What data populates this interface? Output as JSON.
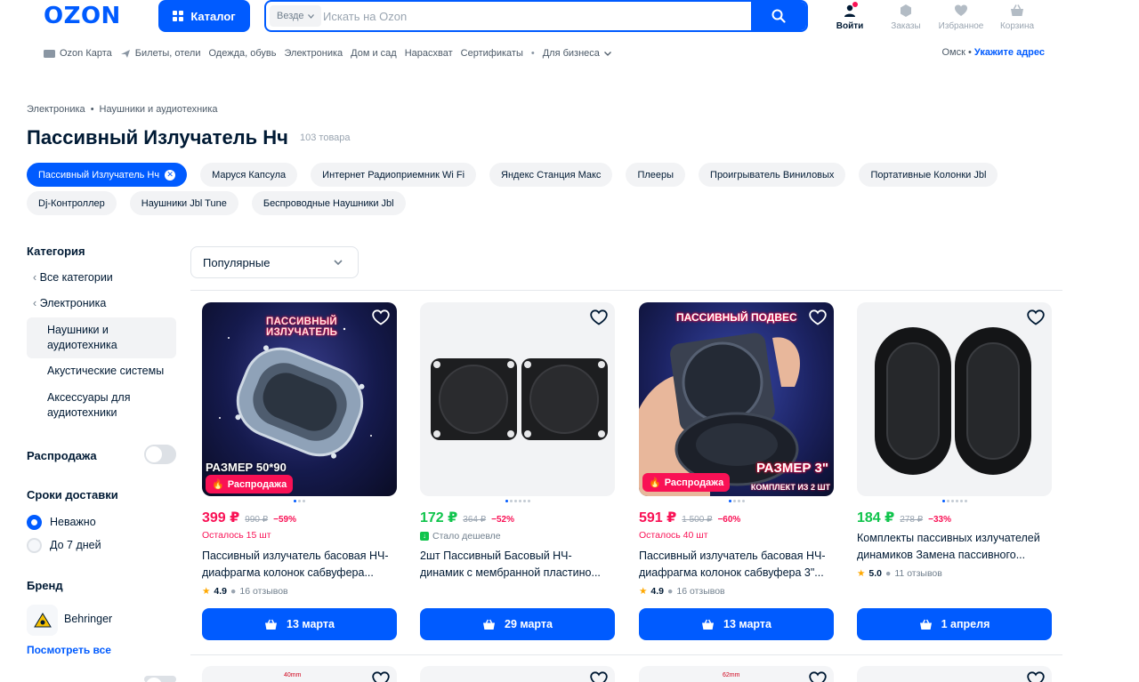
{
  "header": {
    "logo": "OZON",
    "catalog_label": "Каталог",
    "search_scope": "Везде",
    "search_placeholder": "Искать на Ozon",
    "login_label": "Войти",
    "orders_label": "Заказы",
    "favorites_label": "Избранное",
    "cart_label": "Корзина"
  },
  "subnav": {
    "items": [
      "Ozon Карта",
      "Билеты, отели",
      "Одежда, обувь",
      "Электроника",
      "Дом и сад",
      "Нарасхват",
      "Сертификаты",
      "Для бизнеса"
    ],
    "city": "Омск",
    "address_link": "Укажите адрес"
  },
  "breadcrumb": [
    "Электроника",
    "Наушники и аудиотехника"
  ],
  "page": {
    "title": "Пассивный Излучатель Нч",
    "count": "103 товара"
  },
  "chips": [
    "Пассивный Излучатель Нч",
    "Маруся Капсула",
    "Интернет Радиоприемник Wi Fi",
    "Яндекс Станция Макс",
    "Плееры",
    "Проигрыватель Виниловых",
    "Портативные Колонки Jbl",
    "Dj-Контроллер",
    "Наушники Jbl Tune",
    "Беспроводные Наушники Jbl"
  ],
  "sidebar": {
    "category_title": "Категория",
    "all_categories": "Все категории",
    "electronics": "Электроника",
    "current": "Наушники и аудиотехника",
    "sub1": "Акустические системы",
    "sub2": "Аксессуары для аудиотехники",
    "sale_title": "Распродажа",
    "delivery_title": "Сроки доставки",
    "delivery_opt1": "Неважно",
    "delivery_opt2": "До 7 дней",
    "brand_title": "Бренд",
    "brand1": "Behringer",
    "see_all": "Посмотреть все"
  },
  "sort": {
    "selected": "Популярные"
  },
  "products": [
    {
      "image_text_top": "ПАССИВНЫЙ ИЗЛУЧАТЕЛЬ",
      "image_text_bottom": "РАЗМЕР 50*90",
      "badge": "Распродажа",
      "price": "399 ₽",
      "old_price": "990 ₽",
      "discount": "−59%",
      "note": "Осталось 15 шт",
      "name": "Пассивный излучатель басовая НЧ-диафрагма колонок сабвуфера...",
      "rating": "4.9",
      "reviews": "16 отзывов",
      "delivery": "13 марта"
    },
    {
      "price": "172 ₽",
      "old_price": "364 ₽",
      "discount": "−52%",
      "note": "Стало дешевле",
      "name": "2шт Пассивный Басовый НЧ-динамик с мембранной пластино...",
      "delivery": "29 марта"
    },
    {
      "image_text_top": "ПАССИВНЫЙ ПОДВЕС",
      "image_text_bottom": "РАЗМЕР 3\"",
      "image_text_bottom2": "КОМПЛЕКТ ИЗ 2 ШТ",
      "badge": "Распродажа",
      "price": "591 ₽",
      "old_price": "1 500 ₽",
      "discount": "−60%",
      "note": "Осталось 40 шт",
      "name": "Пассивный излучатель басовая НЧ-диафрагма колонок сабвуфера 3\"...",
      "rating": "4.9",
      "reviews": "16 отзывов",
      "delivery": "13 марта"
    },
    {
      "price": "184 ₽",
      "old_price": "278 ₽",
      "discount": "−33%",
      "name": "Комплекты пассивных излучателей динамиков Замена пассивного...",
      "rating": "5.0",
      "reviews": "11 отзывов",
      "delivery": "1 апреля"
    }
  ],
  "next_row": {
    "label1": "40mm",
    "label3": "62mm"
  },
  "colors": {
    "brand": "#005bff",
    "sale": "#f91155",
    "green": "#10c44c"
  }
}
